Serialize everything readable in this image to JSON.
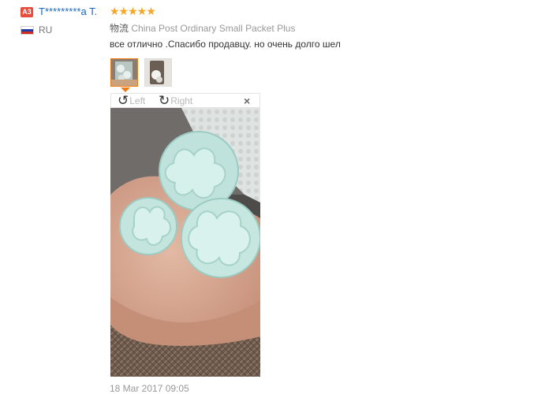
{
  "reviewer": {
    "badge": "A3",
    "name": "T*********a T.",
    "rating_stars": 5,
    "stars_text": "★★★★★",
    "country_code": "RU",
    "flag_colors": [
      "#ffffff",
      "#1c3faa",
      "#d52b1e"
    ]
  },
  "shipping": {
    "label": "物流",
    "method": "China Post Ordinary Small Packet Plus"
  },
  "review": {
    "text": "все отлично .Спасибо продавцу. но очень долго шел"
  },
  "gallery": {
    "thumbnail_count": 2,
    "selected_thumbnail": 1
  },
  "viewer": {
    "rotate_left_label": "Left",
    "rotate_right_label": "Right",
    "rotate_left_icon": "rotate-ccw-icon",
    "rotate_right_icon": "rotate-cw-icon",
    "close_icon": "close-icon",
    "close_symbol": "×"
  },
  "date": "18 Mar 2017 09:05",
  "colors": {
    "accent": "#f27a13",
    "star": "#f5a623",
    "username": "#1a66c2",
    "badge": "#e74c3c"
  }
}
